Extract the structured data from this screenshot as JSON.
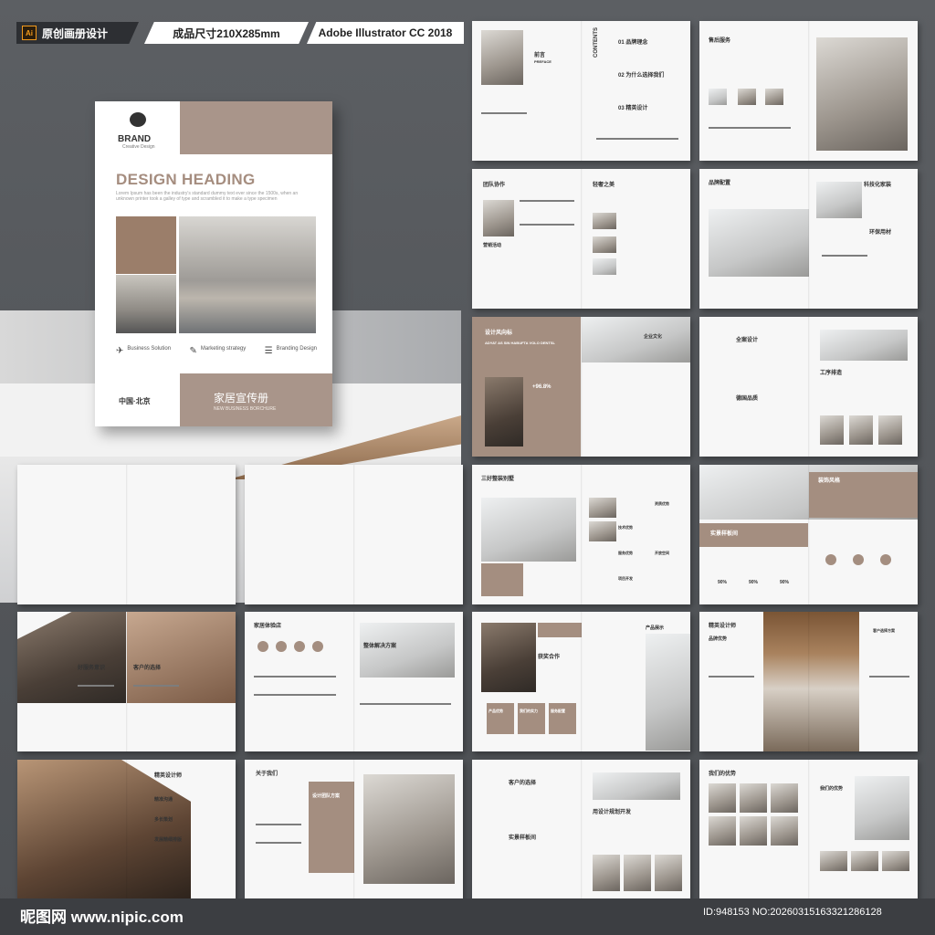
{
  "header": {
    "ai_badge": "Ai",
    "tag1": "原创画册设计",
    "tag2": "成品尺寸210X285mm",
    "tag3": "Adobe Illustrator CC 2018"
  },
  "cover": {
    "brand": "BRAND",
    "brand_sub": "Creative Design",
    "heading": "DESIGN HEADING",
    "subtext": "Lorem Ipsum has been the industry's standard dummy text ever since the 1500s, when an unknown printer took a galley of type and scrambled it to make a type specimen",
    "features": [
      "Business Solution",
      "Marketing strategy",
      "Branding Design"
    ],
    "city": "中国·北京",
    "title_cn": "家居宣传册",
    "title_en": "NEW BUSINESS BORCHURE"
  },
  "spreads": {
    "s1": {
      "left": "前言",
      "left_en": "PREFACE",
      "right": "CONTENTS",
      "items": [
        "01 品牌理念",
        "02 为什么选择我们",
        "03 精英设计"
      ]
    },
    "s2": {
      "left": "售后服务",
      "left_en": "CONTENT HERE"
    },
    "s3": {
      "left": "团队协作",
      "left_en": "INVESTMENT PROMOTION",
      "right": "轻奢之美",
      "right_en": "HIGH TECHNOLOGY",
      "sub": "营销活动"
    },
    "s4": {
      "left": "品牌配置",
      "left_en": "CORE VALUES",
      "right": "科技化家装",
      "right2": "环保用材",
      "ceo": "THE COMPANY CEO"
    },
    "s5": {
      "left": "设计风向标",
      "left_en": "ADYAT AS SIN HABUFTA VOLO DENTSL",
      "stat": "+96.8%",
      "right": "企业文化",
      "right_en": "CULTURE"
    },
    "s6": {
      "left": "全案设计",
      "left_en": "STRATEGIC COOPERATION",
      "left2": "德国品质",
      "left2_en": "CONTENT HERE",
      "right": "工序排造",
      "right_en": "COMPETITION PATTERN"
    },
    "s7": {
      "left": "三好整装别墅",
      "left_en": "CONTENT HERE",
      "items": [
        "资质优势",
        "技术优势",
        "服务优势",
        "开放空间",
        "项目开发"
      ]
    },
    "s8": {
      "left": "实景样板间",
      "left_en": "OUR WORKS",
      "right": "装饰风格",
      "right_en": "PROCESS",
      "stats": [
        "90%",
        "90%",
        "90%"
      ]
    },
    "s9": {
      "left": "好服务意识",
      "left2": "客户的选择",
      "left2_en": "CONTENT HERE"
    },
    "s10": {
      "left": "家居体验店",
      "left_en": "OUR STRENGTHS",
      "right": "整体解决方案"
    },
    "s11": {
      "left": "获奖合作",
      "right": "产品展示",
      "items": [
        "产品优势",
        "我们的实力",
        "服务配置"
      ]
    },
    "s12": {
      "left": "精英设计师",
      "left_en": "SERVICES",
      "left2": "品牌优势",
      "right": "客户选择方案"
    },
    "s13": {
      "left": "精英设计师",
      "items": [
        "精准沟通",
        "多长策划",
        "发展精细排版"
      ]
    },
    "s14": {
      "left": "关于我们",
      "left_en": "FUTURE EXPECTATION",
      "right": "设计团队方案"
    },
    "s15": {
      "left": "客户的选择",
      "left_en": "STRATEGIC COOPERATION",
      "mid": "用设计规划开发",
      "mid_en": "COMPETITION PATTERN",
      "left2": "实景样板间",
      "left2_en": "CONTENT HERE"
    },
    "s16": {
      "left": "我们的优势",
      "left_en": "CONTENT HERE",
      "right": "我们的优势"
    }
  },
  "footer": {
    "site": "昵图网 www.nipic.com",
    "id": "ID:948153 NO:20260315163321286128"
  },
  "colors": {
    "accent": "#a48e80",
    "background": "#55585c"
  }
}
